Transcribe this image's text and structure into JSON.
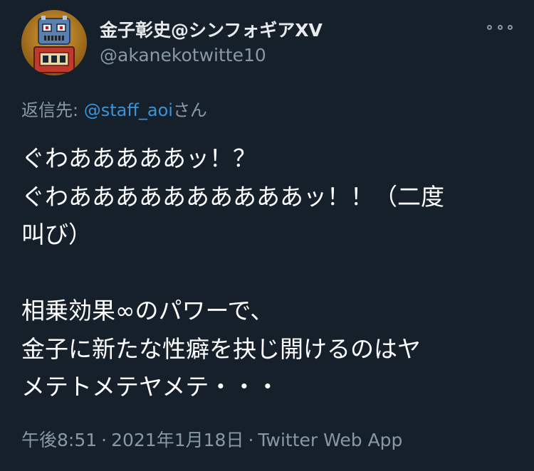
{
  "author": {
    "display_name": "金子彰史@シンフォギアXV",
    "handle": "@akanekotwitte10",
    "avatar_icon": "robot-avatar-icon"
  },
  "more_icon": "more-options-icon",
  "reply": {
    "prefix": "返信先: ",
    "mention": "@staff_aoi",
    "suffix": "さん"
  },
  "tweet": {
    "text": "ぐわあああああッ！？\nぐわああああああああああッ！！（二度\n叫び）\n\n相乗効果∞のパワーで、\n金子に新たな性癖を抉じ開けるのはヤ\nメテトメテヤメテ・・・"
  },
  "meta": {
    "time": "午後8:51",
    "separator": "·",
    "date": "2021年1月18日",
    "source": "Twitter Web App"
  },
  "colors": {
    "background": "#15202b",
    "text": "#ffffff",
    "secondary": "#8899a6",
    "link": "#3b94d9"
  }
}
